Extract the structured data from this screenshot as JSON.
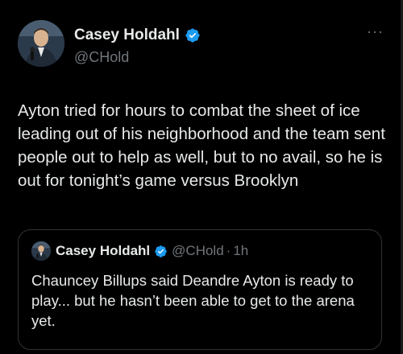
{
  "author": {
    "display_name": "Casey Holdahl",
    "handle": "@CHold",
    "verified": true
  },
  "more_menu": {
    "icon": "more-dots-icon",
    "label": "···"
  },
  "tweet": {
    "text": "Ayton tried for hours to combat the sheet of ice leading out of his neighborhood and the team sent people out to help as well, but to no avail, so he is out for tonight’s game versus Brooklyn"
  },
  "quoted_tweet": {
    "display_name": "Casey Holdahl",
    "handle": "@CHold",
    "separator": "·",
    "time": "1h",
    "verified": true,
    "text": "Chauncey Billups said Deandre Ayton is ready to play... but he hasn’t been able to get to the arena yet."
  },
  "colors": {
    "background": "#000000",
    "text": "#e7e9ea",
    "secondary": "#71767b",
    "verified_badge": "#1d9bf0",
    "border": "#2f3336"
  }
}
